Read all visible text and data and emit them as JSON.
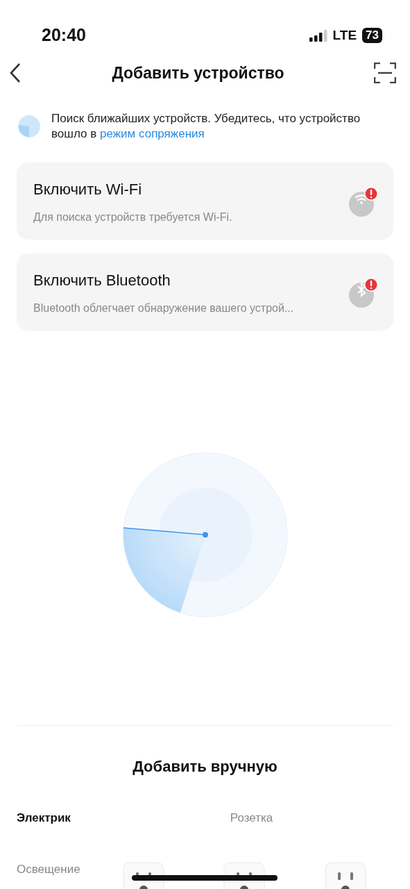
{
  "status_bar": {
    "time": "20:40",
    "network": "LTE",
    "battery": "73"
  },
  "header": {
    "title": "Добавить устройство"
  },
  "scan_info": {
    "text": "Поиск ближайших устройств. Убедитесь, что устройство вошло в",
    "link": "режим сопряжения"
  },
  "cards": [
    {
      "kind": "wifi",
      "title": "Включить Wi-Fi",
      "subtitle": "Для поиска устройств требуется Wi-Fi.",
      "warning": true
    },
    {
      "kind": "bluetooth",
      "title": "Включить Bluetooth",
      "subtitle": "Bluetooth облегчает обнаружение вашего устрой...",
      "warning": true
    }
  ],
  "manual": {
    "title": "Добавить вручную",
    "categories": [
      {
        "label": "Электрик",
        "selected": true
      },
      {
        "label": "Освещение",
        "selected": false
      }
    ],
    "section_title": "Розетка",
    "products": [
      {
        "kind": "socket"
      },
      {
        "kind": "socket"
      },
      {
        "kind": "socket"
      }
    ]
  }
}
